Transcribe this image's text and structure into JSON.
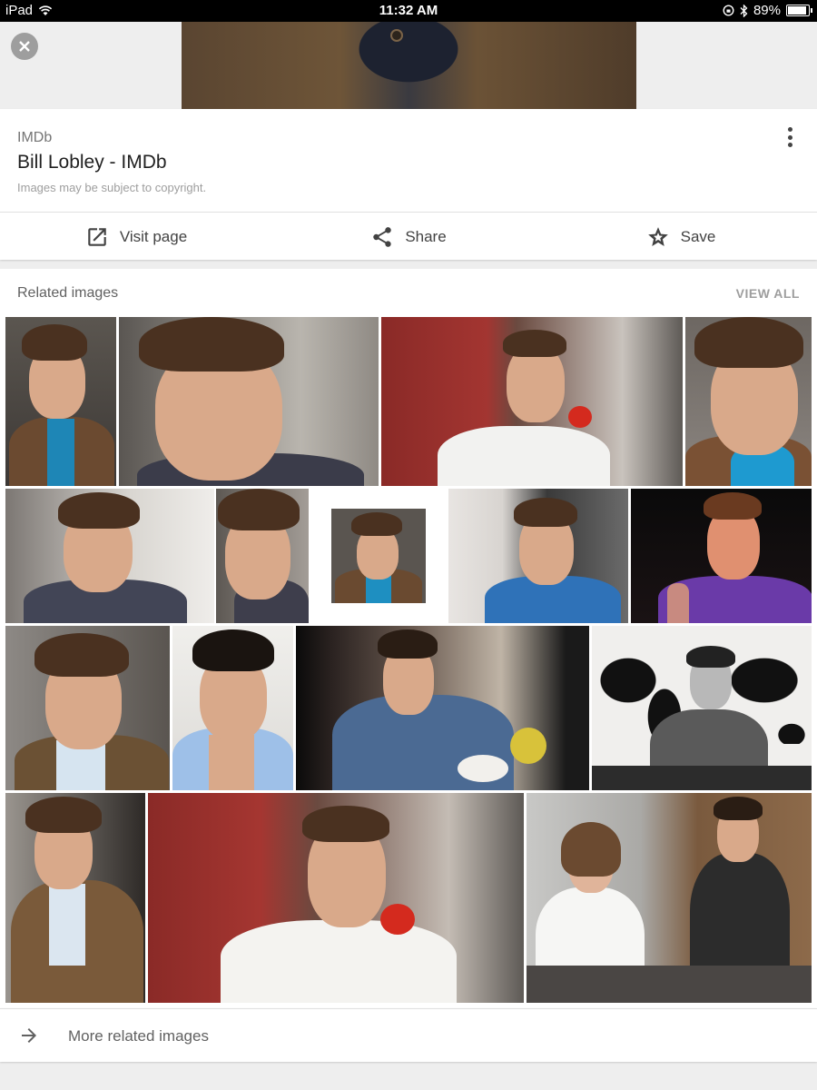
{
  "status_bar": {
    "device": "iPad",
    "time": "11:32 AM",
    "battery": "89%",
    "battery_level": 0.89
  },
  "result": {
    "source": "IMDb",
    "title": "Bill Lobley - IMDb",
    "copyright": "Images may be subject to copyright."
  },
  "actions": {
    "visit": "Visit page",
    "share": "Share",
    "save": "Save"
  },
  "related": {
    "header": "Related images",
    "view_all": "VIEW ALL",
    "more": "More related images"
  },
  "icons": {
    "close": "close-icon",
    "more": "more-vert-icon",
    "visit": "open-in-new-icon",
    "share": "share-icon",
    "save": "star-icon",
    "arrow": "arrow-right-icon"
  }
}
